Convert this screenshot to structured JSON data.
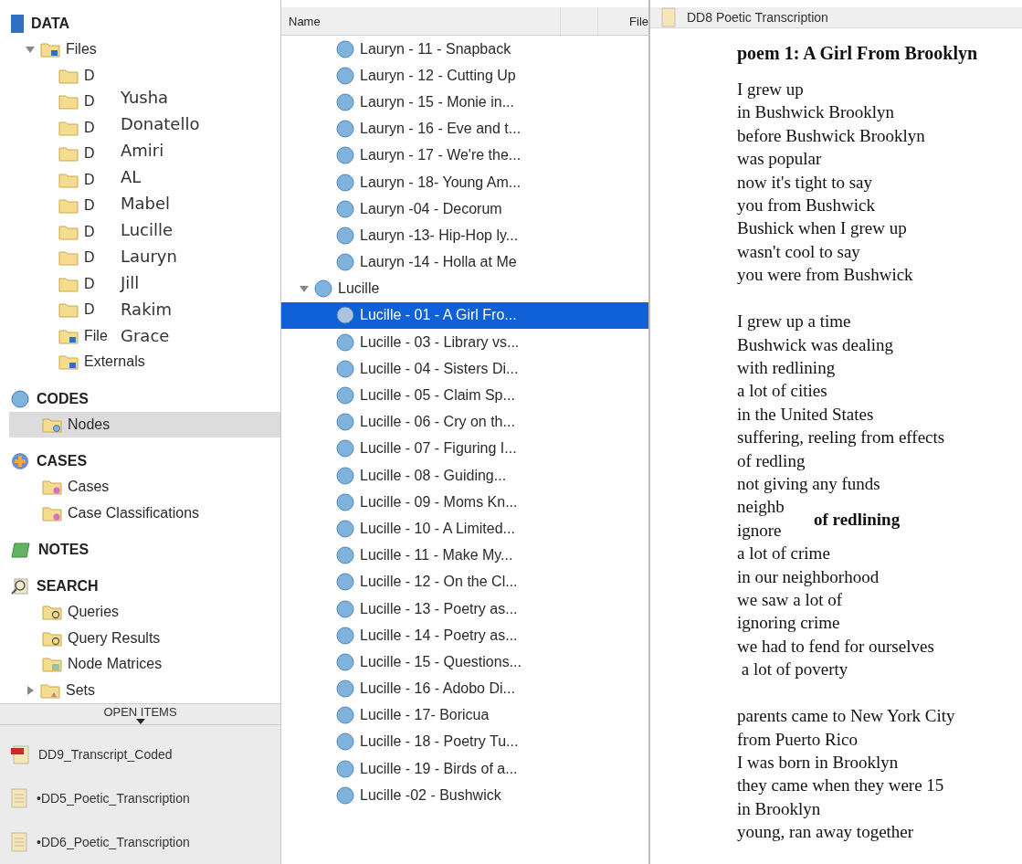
{
  "sidebar": {
    "sections": [
      {
        "kind": "data",
        "title": "DATA",
        "items": [
          {
            "kind": "files",
            "label": "Files",
            "expanded": true,
            "selected": false,
            "children": [
              {
                "label": "D"
              },
              {
                "label": "D"
              },
              {
                "label": "D"
              },
              {
                "label": "D"
              },
              {
                "label": "D"
              },
              {
                "label": "D"
              },
              {
                "label": "D"
              },
              {
                "label": "D"
              },
              {
                "label": "D"
              },
              {
                "label": "D"
              }
            ]
          },
          {
            "kind": "files",
            "label": "File",
            "selected": false
          },
          {
            "kind": "files",
            "label": "Externals",
            "selected": false
          }
        ]
      },
      {
        "kind": "codes",
        "title": "CODES",
        "items": [
          {
            "kind": "nodes",
            "label": "Nodes",
            "selected": true
          }
        ]
      },
      {
        "kind": "cases",
        "title": "CASES",
        "items": [
          {
            "kind": "cases",
            "label": "Cases",
            "selected": false
          },
          {
            "kind": "cases",
            "label": "Case Classifications",
            "selected": false
          }
        ]
      },
      {
        "kind": "notes",
        "title": "NOTES"
      },
      {
        "kind": "search",
        "title": "SEARCH",
        "items": [
          {
            "kind": "query",
            "label": "Queries",
            "selected": false
          },
          {
            "kind": "query",
            "label": "Query Results",
            "selected": false
          },
          {
            "kind": "matrix",
            "label": "Node Matrices",
            "selected": false
          },
          {
            "kind": "sets",
            "label": "Sets",
            "expanded": false,
            "selected": false
          }
        ]
      }
    ],
    "overlay_names": [
      "Yusha",
      "Donatello",
      "Amiri",
      "AL",
      "Mabel",
      "Lucille",
      "Lauryn",
      "Jill",
      "Rakim",
      "Grace"
    ],
    "open_items": {
      "title": "OPEN ITEMS",
      "items": [
        {
          "kind": "pdf",
          "label": "DD9_Transcript_Coded"
        },
        {
          "kind": "doc",
          "label": "•DD5_Poetic_Transcription"
        },
        {
          "kind": "doc",
          "label": "•DD6_Poetic_Transcription"
        }
      ]
    }
  },
  "node_list": {
    "columns": [
      "Name",
      "File"
    ],
    "rows": [
      {
        "label": "Lauryn - 11 - Snapback",
        "selected": false
      },
      {
        "label": "Lauryn - 12 - Cutting Up",
        "selected": false
      },
      {
        "label": "Lauryn - 15 - Monie in...",
        "selected": false
      },
      {
        "label": "Lauryn - 16 - Eve and t...",
        "selected": false
      },
      {
        "label": "Lauryn - 17 - We're the...",
        "selected": false
      },
      {
        "label": "Lauryn - 18- Young Am...",
        "selected": false
      },
      {
        "label": "Lauryn -04 - Decorum",
        "selected": false
      },
      {
        "label": "Lauryn -13- Hip-Hop ly...",
        "selected": false
      },
      {
        "label": "Lauryn -14 - Holla at Me",
        "selected": false
      }
    ],
    "groups": [
      {
        "label": "Lucille",
        "expanded": true,
        "children": [
          {
            "label": "Lucille - 01 - A Girl Fro...",
            "selected": true
          },
          {
            "label": "Lucille - 03 - Library vs...",
            "selected": false
          },
          {
            "label": "Lucille - 04 - Sisters Di...",
            "selected": false
          },
          {
            "label": "Lucille - 05 - Claim Sp...",
            "selected": false
          },
          {
            "label": "Lucille - 06 - Cry on th...",
            "selected": false
          },
          {
            "label": "Lucille - 07 - Figuring I...",
            "selected": false
          },
          {
            "label": "Lucille - 08 - Guiding...",
            "selected": false
          },
          {
            "label": "Lucille - 09 - Moms Kn...",
            "selected": false
          },
          {
            "label": "Lucille - 10 - A Limited...",
            "selected": false
          },
          {
            "label": "Lucille - 11 - Make My...",
            "selected": false
          },
          {
            "label": "Lucille - 12 - On the Cl...",
            "selected": false
          },
          {
            "label": "Lucille - 13 - Poetry as...",
            "selected": false
          },
          {
            "label": "Lucille - 14 - Poetry as...",
            "selected": false
          },
          {
            "label": "Lucille - 15 - Questions...",
            "selected": false
          },
          {
            "label": "Lucille - 16 - Adobo Di...",
            "selected": false
          },
          {
            "label": "Lucille - 17- Boricua",
            "selected": false
          },
          {
            "label": "Lucille - 18 - Poetry Tu...",
            "selected": false
          },
          {
            "label": "Lucille - 19 - Birds of a...",
            "selected": false
          },
          {
            "label": "Lucille -02 - Bushwick",
            "selected": false
          }
        ]
      }
    ]
  },
  "document": {
    "title": "DD8 Poetic Transcription",
    "heading": "poem 1: A Girl From Brooklyn",
    "stanzas": [
      [
        "I grew up",
        "in Bushwick Brooklyn",
        "before Bushwick Brooklyn",
        "was popular",
        "now it's tight to say",
        "you from Bushwick",
        "Bushick when I grew up",
        "wasn't cool to say",
        "you were from Bushwick"
      ],
      [
        "I grew up a time",
        "Bushwick was dealing",
        "with redlining",
        "a lot of cities",
        "in the United States",
        "suffering, reeling from effects",
        "of redling",
        "not giving any funds",
        "neighb",
        "ignore",
        "a lot of crime",
        "in our neighborhood",
        "we saw a lot of",
        "ignoring crime",
        "we had to fend for ourselves",
        " a lot of poverty"
      ],
      [
        "parents came to New York City",
        "from Puerto Rico",
        "I was born in Brooklyn",
        "they came when they were 15",
        "in Brooklyn",
        "young, ran away together"
      ]
    ],
    "overlay_label": "of redlining"
  }
}
